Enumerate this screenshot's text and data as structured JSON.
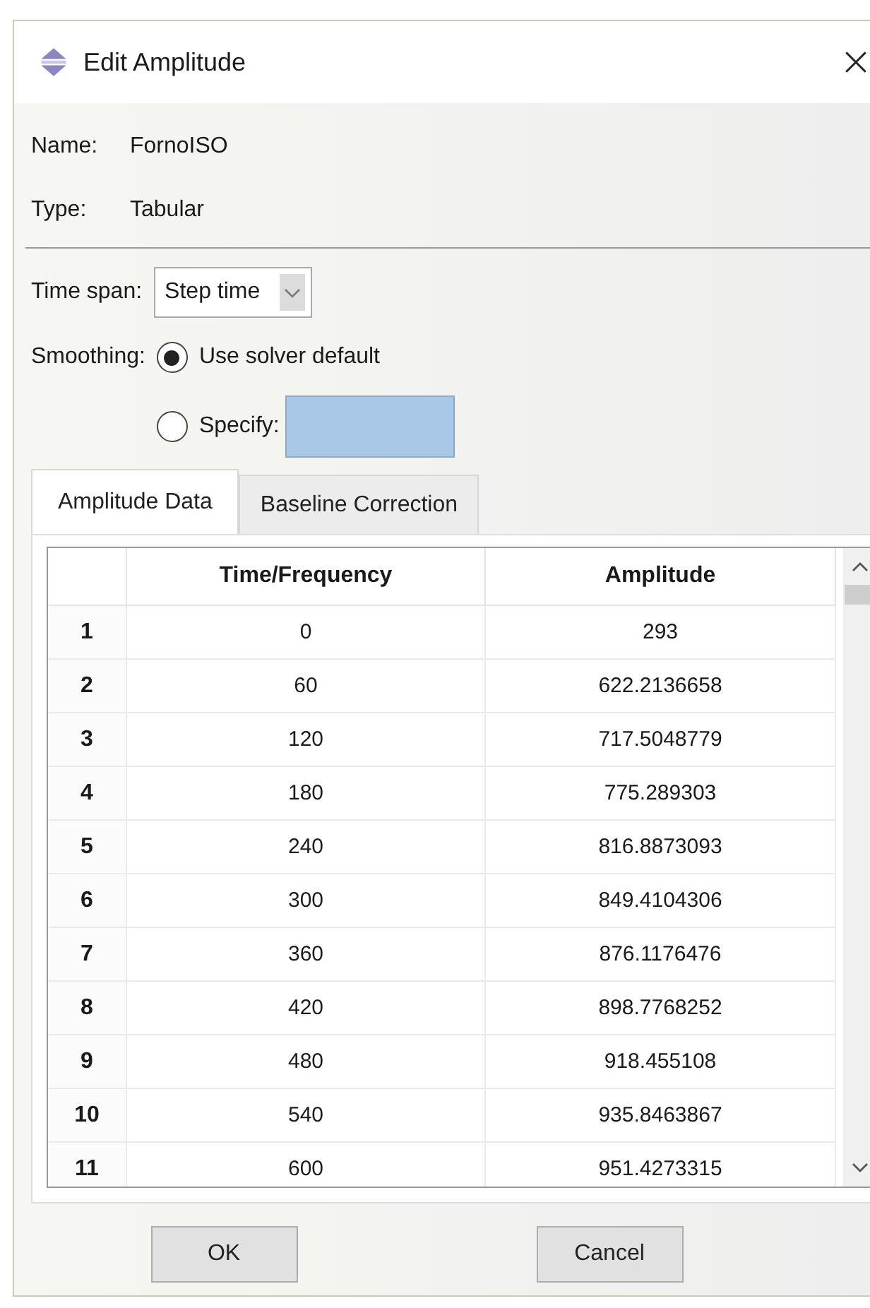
{
  "window": {
    "title": "Edit Amplitude"
  },
  "name": {
    "label": "Name:",
    "value": "FornoISO"
  },
  "type": {
    "label": "Type:",
    "value": "Tabular"
  },
  "time_span": {
    "label": "Time span:",
    "value": "Step time"
  },
  "smoothing": {
    "label": "Smoothing:",
    "options": [
      {
        "label": "Use solver default",
        "selected": true,
        "kind": "plain"
      },
      {
        "label": "Specify:",
        "selected": false,
        "kind": "with_field"
      }
    ]
  },
  "tabs": [
    {
      "label": "Amplitude Data",
      "selected": true
    },
    {
      "label": "Baseline Correction",
      "selected": false
    }
  ],
  "table": {
    "columns": [
      "Time/Frequency",
      "Amplitude"
    ],
    "rows": [
      {
        "index": "1",
        "time": "0",
        "amplitude": "293"
      },
      {
        "index": "2",
        "time": "60",
        "amplitude": "622.2136658"
      },
      {
        "index": "3",
        "time": "120",
        "amplitude": "717.5048779"
      },
      {
        "index": "4",
        "time": "180",
        "amplitude": "775.289303"
      },
      {
        "index": "5",
        "time": "240",
        "amplitude": "816.8873093"
      },
      {
        "index": "6",
        "time": "300",
        "amplitude": "849.4104306"
      },
      {
        "index": "7",
        "time": "360",
        "amplitude": "876.1176476"
      },
      {
        "index": "8",
        "time": "420",
        "amplitude": "898.7768252"
      },
      {
        "index": "9",
        "time": "480",
        "amplitude": "918.455108"
      },
      {
        "index": "10",
        "time": "540",
        "amplitude": "935.8463867"
      },
      {
        "index": "11",
        "time": "600",
        "amplitude": "951.4273315"
      }
    ]
  },
  "buttons": [
    "OK",
    "Cancel"
  ]
}
